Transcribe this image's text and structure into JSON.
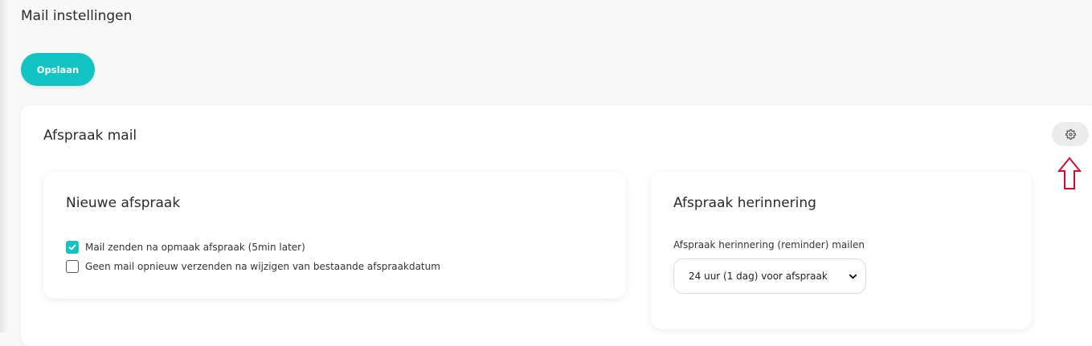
{
  "page": {
    "title": "Mail instellingen",
    "accent_color": "#12c3c4"
  },
  "toolbar": {
    "save_label": "Opslaan"
  },
  "section": {
    "title": "Afspraak mail",
    "settings_icon": "gear-icon",
    "annotation_icon": "arrow-up-outline-icon",
    "annotation_color": "#c8102e"
  },
  "new_appointment": {
    "title": "Nieuwe afspraak",
    "options": [
      {
        "label": "Mail zenden na opmaak afspraak (5min later)",
        "checked": true
      },
      {
        "label": "Geen mail opnieuw verzenden na wijzigen van bestaande afspraakdatum",
        "checked": false
      }
    ]
  },
  "reminder": {
    "title": "Afspraak herinnering",
    "field_label": "Afspraak herinnering (reminder) mailen",
    "selected_value": "24 uur (1 dag) voor afspraak"
  }
}
